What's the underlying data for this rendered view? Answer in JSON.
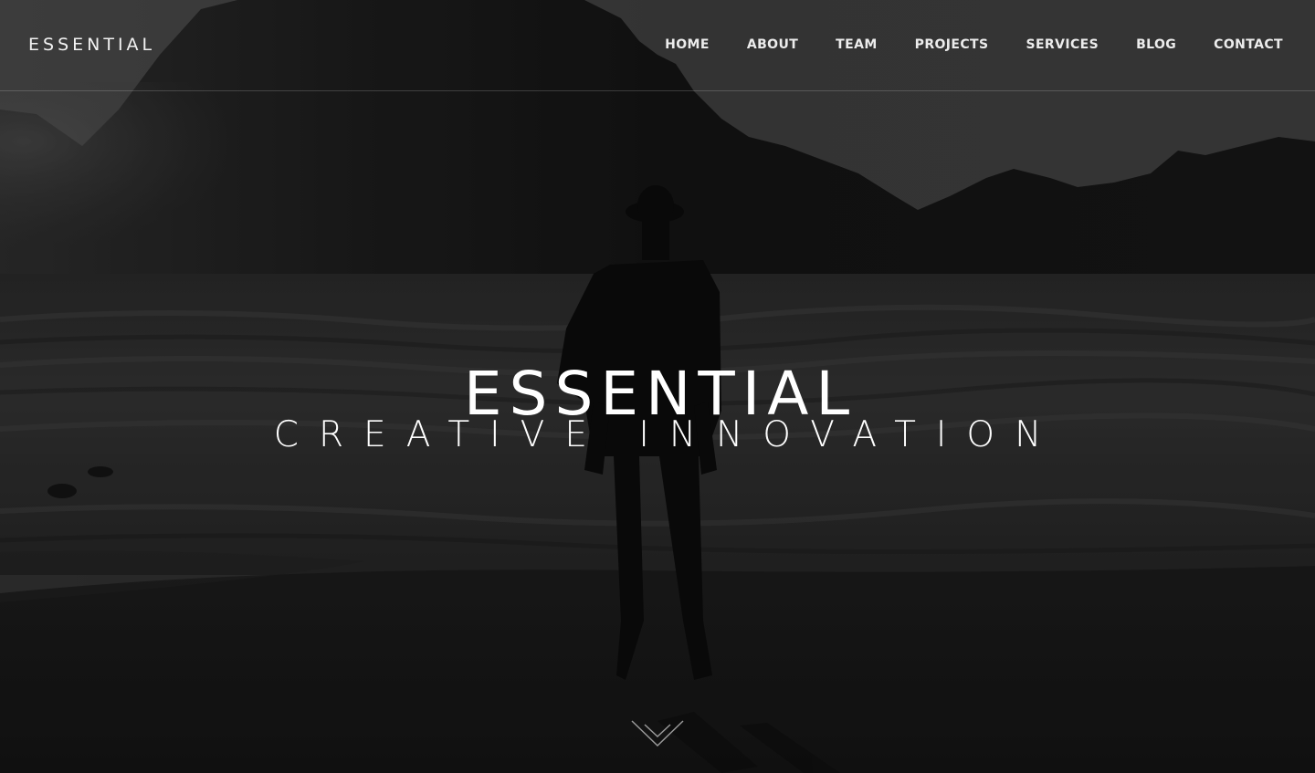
{
  "brand": {
    "name": "ESSENTIAL"
  },
  "nav": {
    "items": [
      {
        "label": "HOME"
      },
      {
        "label": "ABOUT"
      },
      {
        "label": "TEAM"
      },
      {
        "label": "PROJECTS"
      },
      {
        "label": "SERVICES"
      },
      {
        "label": "BLOG"
      },
      {
        "label": "CONTACT"
      }
    ]
  },
  "hero": {
    "title": "ESSENTIAL",
    "subtitle": "CREATIVE INNOVATION",
    "scroll_icon": "double-chevron-down-icon",
    "background_description": "dark monochrome photo of a silhouetted person on a beach with mountains and waves"
  },
  "colors": {
    "text": "#ffffff",
    "nav_text": "#ececec",
    "overlay": "#1c1c1c",
    "sky": "#3e3e3e"
  }
}
